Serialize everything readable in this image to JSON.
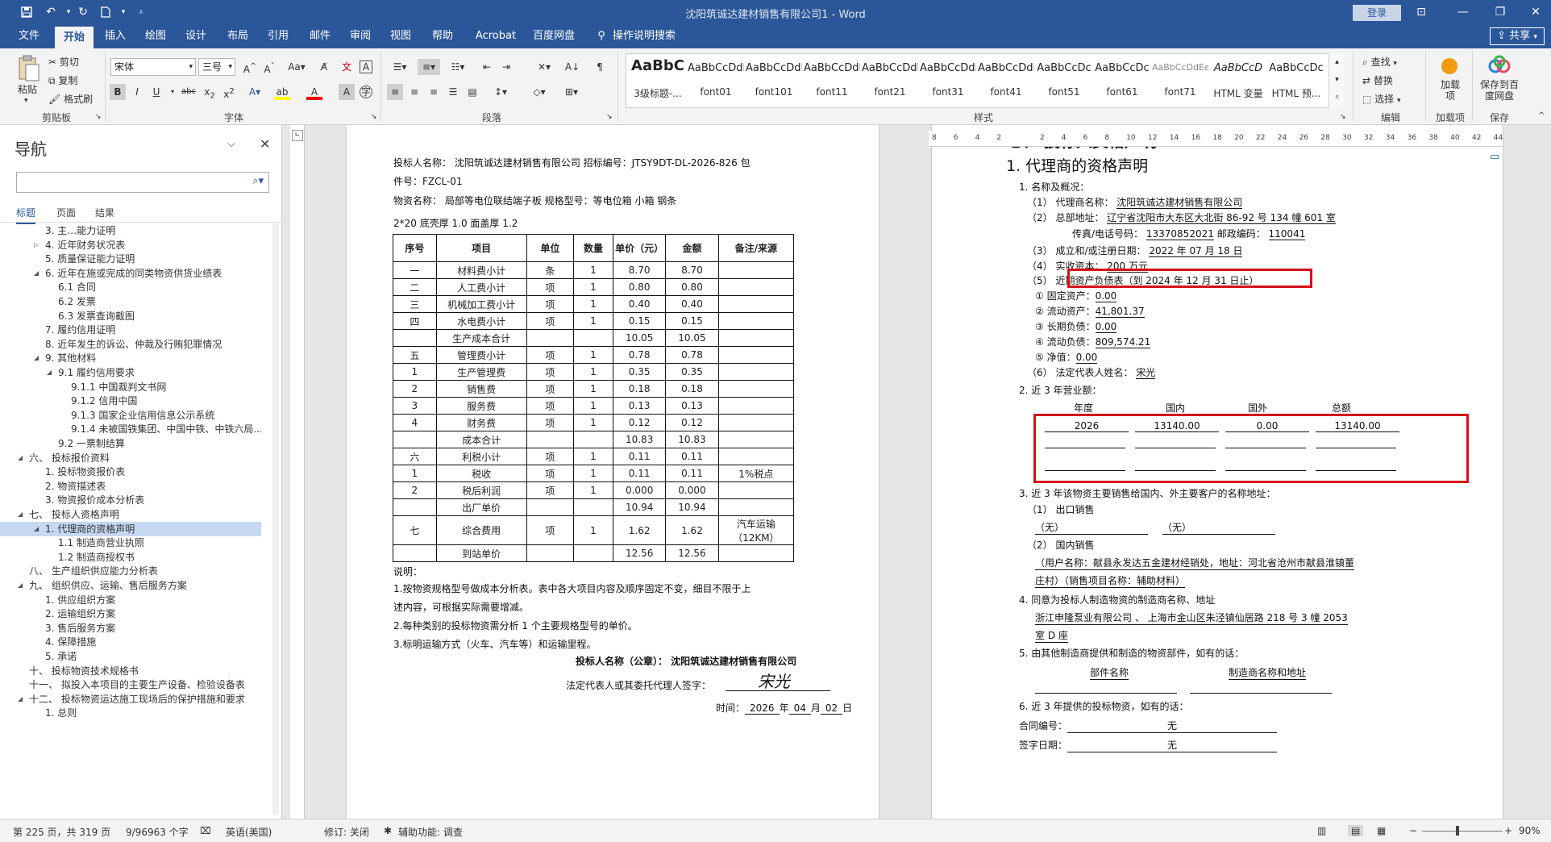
{
  "window": {
    "title": "沈阳筑诚达建材销售有限公司1 - Word",
    "login": "登录",
    "share": "共享"
  },
  "menu": [
    "文件",
    "开始",
    "插入",
    "绘图",
    "设计",
    "布局",
    "引用",
    "邮件",
    "审阅",
    "视图",
    "帮助",
    "Acrobat",
    "百度网盘"
  ],
  "menu_search": "操作说明搜索",
  "ribbon": {
    "clipboard": {
      "paste": "粘贴",
      "cut": "剪切",
      "copy": "复制",
      "format_painter": "格式刷",
      "label": "剪贴板"
    },
    "font": {
      "name": "宋体",
      "size": "三号",
      "label": "字体"
    },
    "paragraph": {
      "label": "段落"
    },
    "styles": {
      "label": "样式",
      "items": [
        {
          "preview": "AaBbC",
          "name": "3级标题-..."
        },
        {
          "preview": "AaBbCcDdI",
          "name": "font01"
        },
        {
          "preview": "AaBbCcDdI",
          "name": "font101"
        },
        {
          "preview": "AaBbCcDdI",
          "name": "font11"
        },
        {
          "preview": "AaBbCcDdI",
          "name": "font21"
        },
        {
          "preview": "AaBbCcDdI",
          "name": "font31"
        },
        {
          "preview": "AaBbCcDdI",
          "name": "font41"
        },
        {
          "preview": "AaBbCcDc",
          "name": "font51"
        },
        {
          "preview": "AaBbCcDc",
          "name": "font61"
        },
        {
          "preview": "AaBbCcDdEe",
          "name": "font71"
        },
        {
          "preview": "AaBbCcD",
          "name": "HTML 变量"
        },
        {
          "preview": "AaBbCcDc",
          "name": "HTML 预..."
        }
      ]
    },
    "editing": {
      "find": "查找",
      "replace": "替换",
      "select": "选择",
      "label": "编辑"
    },
    "addins": {
      "btn": "加载项",
      "label": "加载项"
    },
    "save": {
      "btn": "保存到百度网盘",
      "label": "保存"
    }
  },
  "nav": {
    "title": "导航",
    "tabs": [
      "标题",
      "页面",
      "结果"
    ],
    "items": [
      {
        "level": 2,
        "text": "3. 主…能力证明",
        "tri": ""
      },
      {
        "level": 2,
        "text": "4. 近年财务状况表",
        "tri": "right"
      },
      {
        "level": 2,
        "text": "5. 质量保证能力证明",
        "tri": ""
      },
      {
        "level": 2,
        "text": "6. 近年在施或完成的同类物资供货业绩表",
        "tri": "down"
      },
      {
        "level": 3,
        "text": "6.1 合同",
        "tri": ""
      },
      {
        "level": 3,
        "text": "6.2 发票",
        "tri": ""
      },
      {
        "level": 3,
        "text": "6.3 发票查询截图",
        "tri": ""
      },
      {
        "level": 2,
        "text": "7. 履约信用证明",
        "tri": ""
      },
      {
        "level": 2,
        "text": "8. 近年发生的诉讼、仲裁及行贿犯罪情况",
        "tri": ""
      },
      {
        "level": 2,
        "text": "9. 其他材料",
        "tri": "down"
      },
      {
        "level": 3,
        "text": "9.1 履约信用要求",
        "tri": "down"
      },
      {
        "level": 4,
        "text": "9.1.1 中国裁判文书网",
        "tri": ""
      },
      {
        "level": 4,
        "text": "9.1.2 信用中国",
        "tri": ""
      },
      {
        "level": 4,
        "text": "9.1.3 国家企业信用信息公示系统",
        "tri": ""
      },
      {
        "level": 4,
        "text": "9.1.4 未被国铁集团、中国中铁、中铁六局...",
        "tri": ""
      },
      {
        "level": 3,
        "text": "9.2 一票制结算",
        "tri": ""
      },
      {
        "level": 1,
        "text": "六、 投标报价资料",
        "tri": "down"
      },
      {
        "level": 2,
        "text": "1. 投标物资报价表",
        "tri": ""
      },
      {
        "level": 2,
        "text": "2. 物资描述表",
        "tri": ""
      },
      {
        "level": 2,
        "text": "3. 物资报价成本分析表",
        "tri": ""
      },
      {
        "level": 1,
        "text": "七、 投标人资格声明",
        "tri": "down"
      },
      {
        "level": 2,
        "text": "1. 代理商的资格声明",
        "tri": "down",
        "selected": true
      },
      {
        "level": 3,
        "text": "1.1 制造商营业执照",
        "tri": ""
      },
      {
        "level": 3,
        "text": "1.2 制造商授权书",
        "tri": ""
      },
      {
        "level": 1,
        "text": "八、 生产组织供应能力分析表",
        "tri": ""
      },
      {
        "level": 1,
        "text": "九、 组织供应、运输、售后服务方案",
        "tri": "down"
      },
      {
        "level": 2,
        "text": "1. 供应组织方案",
        "tri": ""
      },
      {
        "level": 2,
        "text": "2. 运输组织方案",
        "tri": ""
      },
      {
        "level": 2,
        "text": "3. 售后服务方案",
        "tri": ""
      },
      {
        "level": 2,
        "text": "4. 保障措施",
        "tri": ""
      },
      {
        "level": 2,
        "text": "5. 承诺",
        "tri": ""
      },
      {
        "level": 1,
        "text": "十、 投标物资技术规格书",
        "tri": ""
      },
      {
        "level": 1,
        "text": "十一、 拟投入本项目的主要生产设备、检验设备表",
        "tri": ""
      },
      {
        "level": 1,
        "text": "十二、 投标物资运达施工现场后的保护措施和要求",
        "tri": "down"
      },
      {
        "level": 2,
        "text": "1. 总则",
        "tri": ""
      }
    ]
  },
  "ruler_ticks": [
    "8",
    "6",
    "4",
    "2",
    "",
    "2",
    "4",
    "6",
    "8",
    "10",
    "12",
    "14",
    "16",
    "18",
    "20",
    "22",
    "24",
    "26",
    "28",
    "30",
    "32",
    "34",
    "36",
    "38",
    "40",
    "42",
    "44"
  ],
  "page1": {
    "header_line1": "投标人名称： 沈阳筑诚达建材销售有限公司  招标编号：JTSY9DT-DL-2026-826   包",
    "header_line2": "件号：FZCL-01",
    "material_line": "物资名称：  局部等电位联结端子板             规格型号：等电位箱 小箱 钢条",
    "material_line2": "2*20 底壳厚 1.0 面盖厚 1.2",
    "table_headers": [
      "序号",
      "项目",
      "单位",
      "数量",
      "单价（元）",
      "金额",
      "备注/来源"
    ],
    "table_rows": [
      [
        "一",
        "材料费小计",
        "条",
        "1",
        "8.70",
        "8.70",
        ""
      ],
      [
        "二",
        "人工费小计",
        "项",
        "1",
        "0.80",
        "0.80",
        ""
      ],
      [
        "三",
        "机械加工费小计",
        "项",
        "1",
        "0.40",
        "0.40",
        ""
      ],
      [
        "四",
        "水电费小计",
        "项",
        "1",
        "0.15",
        "0.15",
        ""
      ],
      [
        "",
        "生产成本合计",
        "",
        "",
        "10.05",
        "10.05",
        ""
      ],
      [
        "五",
        "管理费小计",
        "项",
        "1",
        "0.78",
        "0.78",
        ""
      ],
      [
        "1",
        "生产管理费",
        "项",
        "1",
        "0.35",
        "0.35",
        ""
      ],
      [
        "2",
        "销售费",
        "项",
        "1",
        "0.18",
        "0.18",
        ""
      ],
      [
        "3",
        "服务费",
        "项",
        "1",
        "0.13",
        "0.13",
        ""
      ],
      [
        "4",
        "财务费",
        "项",
        "1",
        "0.12",
        "0.12",
        ""
      ],
      [
        "",
        "成本合计",
        "",
        "",
        "10.83",
        "10.83",
        ""
      ],
      [
        "六",
        "利税小计",
        "项",
        "1",
        "0.11",
        "0.11",
        ""
      ],
      [
        "1",
        "税收",
        "项",
        "1",
        "0.11",
        "0.11",
        "1%税点"
      ],
      [
        "2",
        "税后利润",
        "项",
        "1",
        "0.000",
        "0.000",
        ""
      ],
      [
        "",
        "出厂单价",
        "",
        "",
        "10.94",
        "10.94",
        ""
      ],
      [
        "七",
        "综合费用",
        "项",
        "1",
        "1.62",
        "1.62",
        "汽车运输（12KM）"
      ],
      [
        "",
        "到站单价",
        "",
        "",
        "12.56",
        "12.56",
        ""
      ]
    ],
    "notes_title": "说明：",
    "notes": [
      "1.按物资规格型号做成本分析表。表中各大项目内容及顺序固定不变，细目不限于上",
      "述内容，可根据实际需要增减。",
      "2.每种类别的投标物资需分析 1 个主要规格型号的单价。",
      "3.标明运输方式（火车、汽车等）和运输里程。"
    ],
    "sign_company": "投标人名称（公章）：  沈阳筑诚达建材销售有限公司",
    "sign_rep": "法定代表人或其委托代理人签字：",
    "signature": "宋光",
    "date_label": "时间：",
    "date_y": "2026",
    "date_m": "04",
    "date_d": "02",
    "y_char": "年",
    "m_char": "月",
    "d_char": "日"
  },
  "page2": {
    "h1": "七、 投标人资格声明",
    "h2": "1. 代理商的资格声明",
    "s1": "1. 名称及概况：",
    "agent_name_label": "（1）  代理商名称：",
    "agent_name": "沈阳筑诚达建材销售有限公司",
    "address_label": "（2）  总部地址：",
    "address": "辽宁省沈阳市大东区大北街 86-92 号 134 幢 601 室",
    "fax_label": "传真/电话号码：",
    "fax": "13370852021",
    "zip_label": "邮政编码：",
    "zip": "110041",
    "est_label": "（3）  成立和/或注册日期：",
    "est": "2022 年 07 月 18 日",
    "capital_label": "（4）  实收资本：",
    "capital": "200 万元",
    "balance_label": "（5）  近期资产负债表（到  2024  年  12  月  31  日止）",
    "b1_label": "①  固定资产：",
    "b1": "0.00",
    "b2_label": "②  流动资产：",
    "b2": "41,801.37",
    "b3_label": "③  长期负债：",
    "b3": "0.00",
    "b4_label": "④  流动负债：",
    "b4": "809,574.21",
    "b5_label": "⑤  净值：",
    "b5": "0.00",
    "legal_label": "（6）  法定代表人姓名：",
    "legal": "宋光",
    "s2": "2. 近 3 年营业额：",
    "rev_headers": [
      "年度",
      "国内",
      "国外",
      "总额"
    ],
    "rev_row": [
      "2026",
      "13140.00",
      "0.00",
      "13140.00"
    ],
    "s3": "3. 近 3 年该物资主要销售给国内、外主要客户的名称地址：",
    "export_label": "（1）   出口销售",
    "none1": "（无）",
    "none2": "（无）",
    "domestic_label": "（2）   国内销售",
    "domestic_1": "（用户名称：献县永发达五金建材经销处，地址：河北省沧州市献县淮镇董",
    "domestic_2": "庄村）（销售项目名称：辅助材料）",
    "s4": "4. 同意为投标人制造物资的制造商名称、地址",
    "mfr_1": "浙江申隆泵业有限公司     、  上海市金山区朱泾镇仙居路 218 号 3 幢 2053",
    "mfr_2": "室 D 座",
    "s5": "5. 由其他制造商提供和制造的物资部件，如有的话：",
    "part_name": "部件名称",
    "mfr_name_addr": "制造商名称和地址",
    "s6": "6. 近 3 年提供的投标物资，如有的话：",
    "contract_label": "合同编号：",
    "contract": "无",
    "sign_date_label": "签字日期：",
    "sign_date": "无"
  },
  "status": {
    "page": "第 225 页，共 319 页",
    "words": "9/96963 个字",
    "lang": "英语(美国)",
    "track": "修订: 关闭",
    "access": "辅助功能: 调查",
    "zoom": "90%"
  },
  "colors": {
    "brand": "#2b579a",
    "red_box": "#d4111a",
    "nav_sel": "#c5d7f1"
  }
}
